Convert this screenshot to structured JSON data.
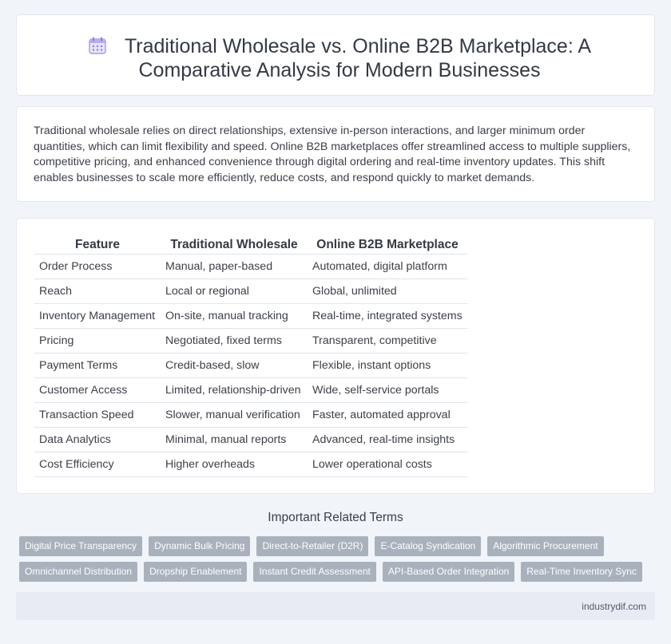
{
  "header": {
    "title": "Traditional Wholesale vs. Online B2B Marketplace: A Comparative Analysis for Modern Businesses",
    "icon": "calendar-icon"
  },
  "intro": {
    "text": "Traditional wholesale relies on direct relationships, extensive in-person interactions, and larger minimum order quantities, which can limit flexibility and speed. Online B2B marketplaces offer streamlined access to multiple suppliers, competitive pricing, and enhanced convenience through digital ordering and real-time inventory updates. This shift enables businesses to scale more efficiently, reduce costs, and respond quickly to market demands."
  },
  "table": {
    "headers": [
      "Feature",
      "Traditional Wholesale",
      "Online B2B Marketplace"
    ],
    "rows": [
      [
        "Order Process",
        "Manual, paper-based",
        "Automated, digital platform"
      ],
      [
        "Reach",
        "Local or regional",
        "Global, unlimited"
      ],
      [
        "Inventory Management",
        "On-site, manual tracking",
        "Real-time, integrated systems"
      ],
      [
        "Pricing",
        "Negotiated, fixed terms",
        "Transparent, competitive"
      ],
      [
        "Payment Terms",
        "Credit-based, slow",
        "Flexible, instant options"
      ],
      [
        "Customer Access",
        "Limited, relationship-driven",
        "Wide, self-service portals"
      ],
      [
        "Transaction Speed",
        "Slower, manual verification",
        "Faster, automated approval"
      ],
      [
        "Data Analytics",
        "Minimal, manual reports",
        "Advanced, real-time insights"
      ],
      [
        "Cost Efficiency",
        "Higher overheads",
        "Lower operational costs"
      ]
    ]
  },
  "related": {
    "title": "Important Related Terms",
    "row1": [
      "Digital Price Transparency",
      "Dynamic Bulk Pricing",
      "Direct-to-Retailer (D2R)",
      "E-Catalog Syndication",
      "Algorithmic Procurement"
    ],
    "row2": [
      "Omnichannel Distribution",
      "Dropship Enablement",
      "Instant Credit Assessment",
      "API-Based Order Integration",
      "Real-Time Inventory Sync"
    ]
  },
  "footer": {
    "site": "industrydif.com"
  },
  "colors": {
    "background": "#f1f4f9",
    "tag": "#a9b1bd",
    "footer": "#e6ebf4",
    "icon_accent": "#8f7bd6"
  }
}
